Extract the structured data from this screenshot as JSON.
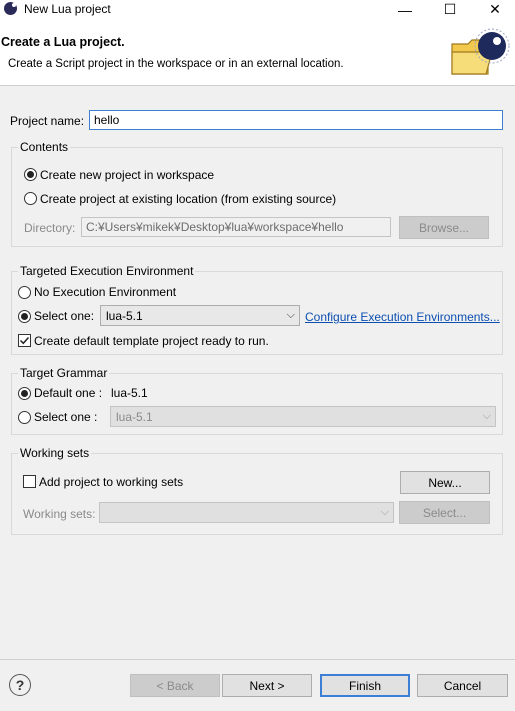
{
  "window": {
    "title": "New Lua project",
    "minimize": "—",
    "maximize": "☐",
    "close": "✕"
  },
  "banner": {
    "title": "Create a Lua project.",
    "description": "Create a Script project in the workspace or in an external location."
  },
  "project_name": {
    "label": "Project name:",
    "value": "hello"
  },
  "contents": {
    "title": "Contents",
    "option_workspace": "Create new project in workspace",
    "option_existing": "Create project at existing location (from existing source)",
    "directory_label": "Directory:",
    "directory_value": "C:¥Users¥mikek¥Desktop¥lua¥workspace¥hello",
    "browse_label": "Browse..."
  },
  "execution_env": {
    "title": "Targeted Execution Environment",
    "option_none": "No Execution Environment",
    "option_select": "Select one:",
    "selected_value": "lua-5.1",
    "configure_link": "Configure Execution Environments...",
    "template_checkbox": "Create default template project ready to run."
  },
  "grammar": {
    "title": "Target Grammar",
    "option_default": "Default one :",
    "default_value": "lua-5.1",
    "option_select": "Select one :",
    "select_value": "lua-5.1"
  },
  "working_sets": {
    "title": "Working sets",
    "add_checkbox": "Add project to working sets",
    "new_button": "New...",
    "label": "Working sets:",
    "select_button": "Select..."
  },
  "footer": {
    "help": "?",
    "back": "< Back",
    "next": "Next >",
    "finish": "Finish",
    "cancel": "Cancel"
  },
  "colors": {
    "accent": "#3d7fd4",
    "link": "#0c4fb1",
    "dialog_bg": "#f0f0f0"
  },
  "icons": [
    "lua-app-icon",
    "folder-moon-icon",
    "help-icon",
    "chevron-down-icon"
  ]
}
